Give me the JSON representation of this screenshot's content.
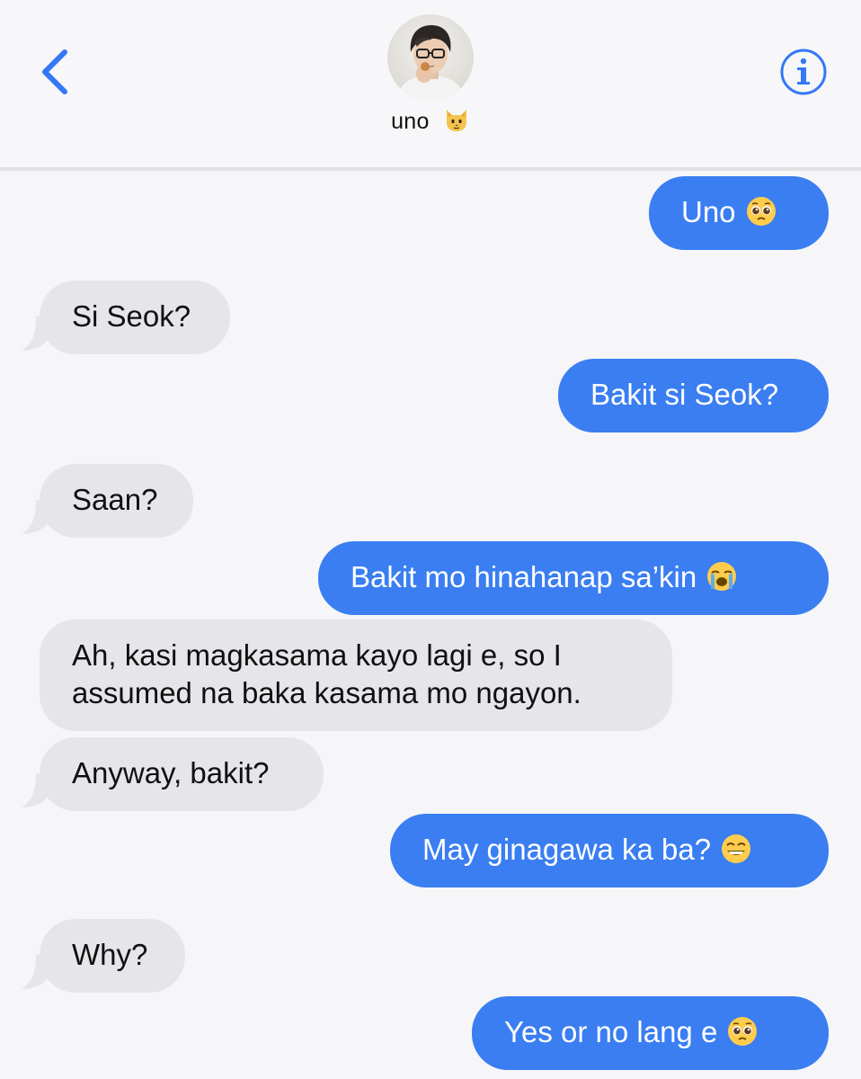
{
  "header": {
    "contact_name": "uno",
    "contact_emoji": "cat-face-icon",
    "back_icon": "chevron-left-icon",
    "info_icon": "info-icon",
    "accent_color": "#3478f6"
  },
  "messages": [
    {
      "direction": "outgoing",
      "text": "Uno",
      "emoji": "pleading-face-icon"
    },
    {
      "direction": "incoming",
      "text": "Si Seok?"
    },
    {
      "direction": "outgoing",
      "text": "Bakit si Seok?"
    },
    {
      "direction": "incoming",
      "text": "Saan?"
    },
    {
      "direction": "outgoing",
      "text": "Bakit mo hinahanap sa’kin",
      "emoji": "loudly-crying-face-icon"
    },
    {
      "direction": "incoming",
      "text": "Ah, kasi magkasama kayo lagi e, so I",
      "text2": "assumed na baka kasama mo ngayon."
    },
    {
      "direction": "incoming",
      "text": "Anyway, bakit?"
    },
    {
      "direction": "outgoing",
      "text": "May ginagawa ka ba?",
      "emoji": "grinning-face-icon"
    },
    {
      "direction": "incoming",
      "text": "Why?"
    },
    {
      "direction": "outgoing",
      "text": "Yes or no lang e",
      "emoji": "pleading-face-icon"
    }
  ],
  "colors": {
    "outgoing_bubble": "#3a7ef2",
    "incoming_bubble": "#e6e6ea",
    "background": "#f6f6f8"
  }
}
